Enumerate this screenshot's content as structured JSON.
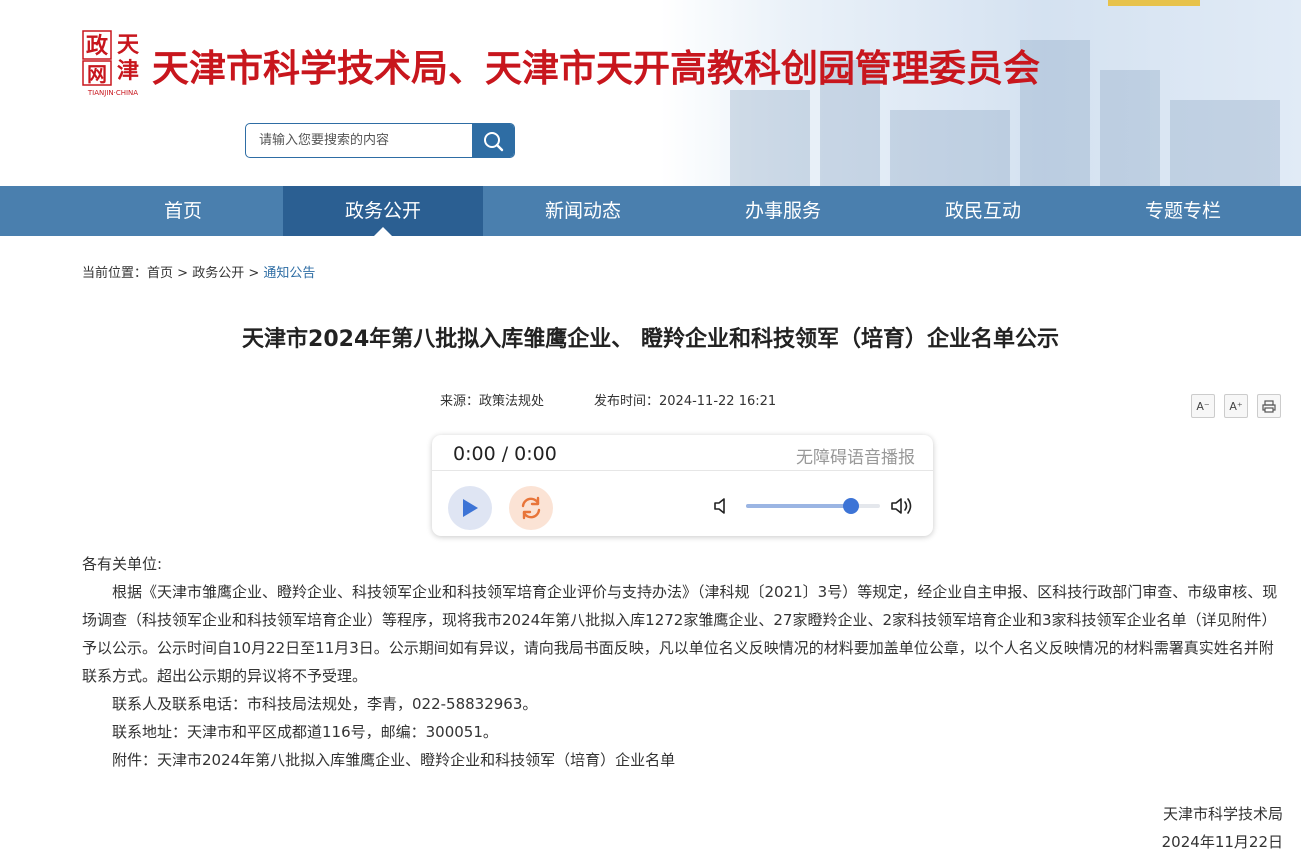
{
  "header": {
    "site_title": "天津市科学技术局、天津市天开高教科创园管理委员会",
    "logo_caption": "TIANJIN·CHINA",
    "logo_text": "天津",
    "search_placeholder": "请输入您要搜索的内容"
  },
  "nav": {
    "items": [
      {
        "label": "首页"
      },
      {
        "label": "政务公开"
      },
      {
        "label": "新闻动态"
      },
      {
        "label": "办事服务"
      },
      {
        "label": "政民互动"
      },
      {
        "label": "专题专栏"
      }
    ],
    "active": "政务公开"
  },
  "breadcrumb": {
    "prefix": "当前位置：",
    "items": [
      "首页",
      "政务公开",
      "通知公告"
    ],
    "separator": ">"
  },
  "article": {
    "title": "天津市2024年第八批拟入库雏鹰企业、 瞪羚企业和科技领军（培育）企业名单公示",
    "source": "来源：政策法规处",
    "publish_time": "发布时间：2024-11-22 16:21",
    "font_decrease": "A⁻",
    "font_increase": "A⁺",
    "salutation": "各有关单位:",
    "paragraphs": [
      "根据《天津市雏鹰企业、瞪羚企业、科技领军企业和科技领军培育企业评价与支持办法》（津科规〔2021〕3号）等规定，经企业自主申报、区科技行政部门审查、市级审核、现场调查（科技领军企业和科技领军培育企业）等程序，现将我市2024年第八批拟入库1272家雏鹰企业、27家瞪羚企业、2家科技领军培育企业和3家科技领军企业名单（详见附件）予以公示。公示时间自10月22日至11月3日。公示期间如有异议，请向我局书面反映，凡以单位名义反映情况的材料要加盖单位公章，以个人名义反映情况的材料需署真实姓名并附联系方式。超出公示期的异议将不予受理。",
      "联系人及联系电话：市科技局法规处，李青，022-58832963。",
      "联系地址：天津市和平区成都道116号，邮编：300051。",
      "附件：天津市2024年第八批拟入库雏鹰企业、瞪羚企业和科技领军（培育）企业名单"
    ],
    "signature_org": "天津市科学技术局",
    "signature_date": "2024年11月22日"
  },
  "player": {
    "time": "0:00 / 0:00",
    "label": "无障碍语音播报",
    "volume": 0.78,
    "colors": {
      "play": "#3d74d6",
      "loop": "#e8753a"
    }
  },
  "colors": {
    "nav_bg": "#4a7fae",
    "nav_active": "#2b5f92",
    "title_red": "#c8161d",
    "link_blue": "#2e6da4"
  }
}
